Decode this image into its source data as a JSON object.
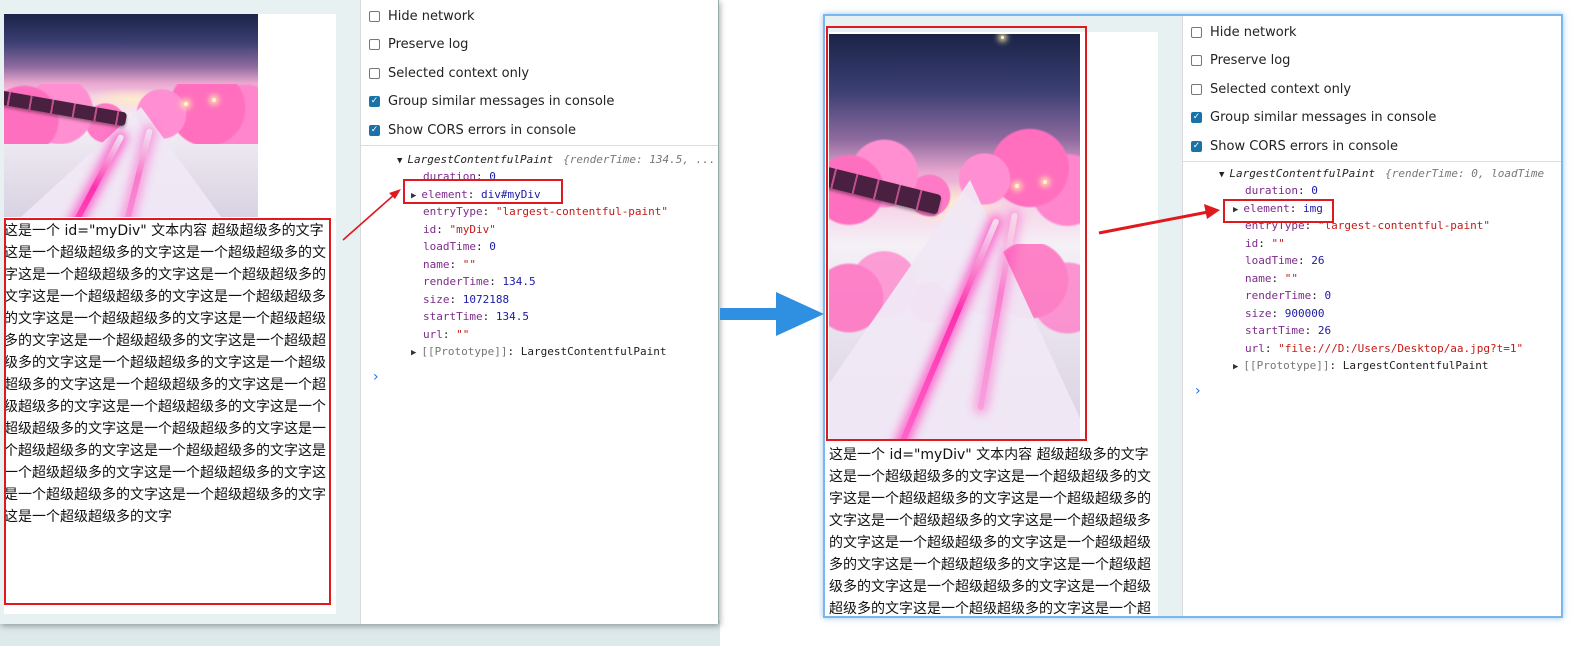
{
  "settings": [
    {
      "label": "Hide network",
      "checked": false
    },
    {
      "label": "Preserve log",
      "checked": false
    },
    {
      "label": "Selected context only",
      "checked": false
    },
    {
      "label": "Group similar messages in console",
      "checked": true
    },
    {
      "label": "Show CORS errors in console",
      "checked": true
    }
  ],
  "paragraph": "这是一个 id=\"myDiv\" 文本内容 超级超级多的文字这是一个超级超级多的文字这是一个超级超级多的文字这是一个超级超级多的文字这是一个超级超级多的文字这是一个超级超级多的文字这是一个超级超级多的文字这是一个超级超级多的文字这是一个超级超级多的文字这是一个超级超级多的文字这是一个超级超级多的文字这是一个超级超级多的文字这是一个超级超级多的文字这是一个超级超级多的文字这是一个超级超级多的文字这是一个超级超级多的文字这是一个超级超级多的文字这是一个超级超级多的文字这是一个超级超级多的文字这是一个超级超级多的文字这是一个超级超级多的文字这是一个超级超级多的文字这是一个超级超级多的文字这是一个超级超级多的文字这是一个超级超级多的文字",
  "left": {
    "lcp_title": "LargestContentfulPaint",
    "lcp_preview": "{renderTime: 134.5, ...",
    "props": [
      {
        "key": "duration",
        "value": "0",
        "type": "num"
      },
      {
        "key": "element",
        "value": "div#myDiv",
        "type": "dom",
        "expandable": true
      },
      {
        "key": "entryType",
        "value": "\"largest-contentful-paint\"",
        "type": "str"
      },
      {
        "key": "id",
        "value": "\"myDiv\"",
        "type": "str"
      },
      {
        "key": "loadTime",
        "value": "0",
        "type": "num"
      },
      {
        "key": "name",
        "value": "\"\"",
        "type": "str"
      },
      {
        "key": "renderTime",
        "value": "134.5",
        "type": "num"
      },
      {
        "key": "size",
        "value": "1072188",
        "type": "num"
      },
      {
        "key": "startTime",
        "value": "134.5",
        "type": "num"
      },
      {
        "key": "url",
        "value": "\"\"",
        "type": "str"
      }
    ],
    "prototype_key": "[[Prototype]]",
    "prototype_value": "LargestContentfulPaint"
  },
  "right": {
    "lcp_title": "LargestContentfulPaint",
    "lcp_preview": "{renderTime: 0, loadTime",
    "props": [
      {
        "key": "duration",
        "value": "0",
        "type": "num"
      },
      {
        "key": "element",
        "value": "img",
        "type": "dom",
        "expandable": true
      },
      {
        "key": "entryType",
        "value": "\"largest-contentful-paint\"",
        "type": "str"
      },
      {
        "key": "id",
        "value": "\"\"",
        "type": "str"
      },
      {
        "key": "loadTime",
        "value": "26",
        "type": "num"
      },
      {
        "key": "name",
        "value": "\"\"",
        "type": "str"
      },
      {
        "key": "renderTime",
        "value": "0",
        "type": "num"
      },
      {
        "key": "size",
        "value": "900000",
        "type": "num"
      },
      {
        "key": "startTime",
        "value": "26",
        "type": "num"
      },
      {
        "key": "url",
        "value": "\"file:///D:/Users/Desktop/aa.jpg?t=1\"",
        "type": "str"
      }
    ],
    "prototype_key": "[[Prototype]]",
    "prototype_value": "LargestContentfulPaint"
  },
  "prompt_glyph": "›",
  "colors": {
    "highlight_red": "#e0191f",
    "arrow_blue": "#2f8fe0",
    "checkbox_blue": "#1a73a8"
  }
}
